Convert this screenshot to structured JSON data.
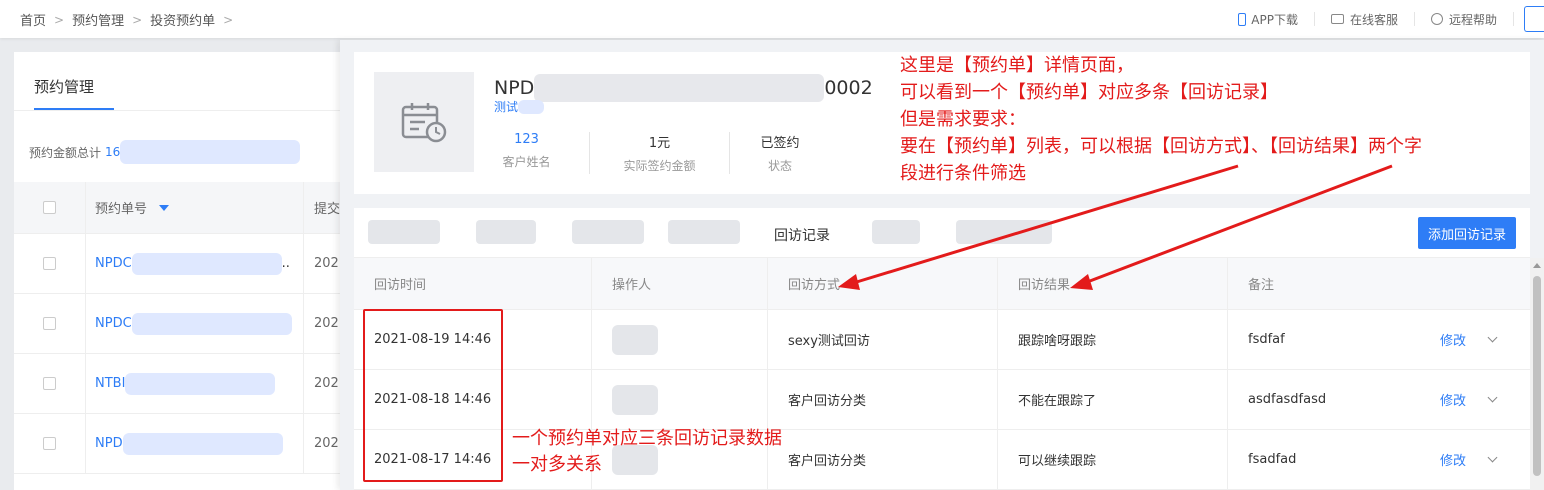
{
  "breadcrumb": [
    "首页",
    "预约管理",
    "投资预约单"
  ],
  "topbar": {
    "app_download": "APP下载",
    "online_service": "在线客服",
    "remote_help": "远程帮助"
  },
  "left_panel": {
    "title": "预约管理",
    "total_label": "预约金额总计",
    "total_value": "16",
    "col_order_no": "预约单号",
    "col_submit": "提交",
    "rows": [
      {
        "order_no": "NPDC",
        "submit": "202"
      },
      {
        "order_no": "NPDC",
        "submit": "202"
      },
      {
        "order_no": "NTBI",
        "submit": "202"
      },
      {
        "order_no": "NPD",
        "submit": "202"
      }
    ]
  },
  "detail": {
    "title_prefix": "NPD",
    "title_suffix": "0002",
    "subtitle": "测试",
    "stats": [
      {
        "value": "123",
        "label": "客户姓名"
      },
      {
        "value": "1元",
        "label": "实际签约金额"
      },
      {
        "value": "已签约",
        "label": "状态"
      }
    ],
    "active_tab": "回访记录",
    "add_button": "添加回访记录",
    "columns": [
      "回访时间",
      "操作人",
      "回访方式",
      "回访结果",
      "备注"
    ],
    "records": [
      {
        "time": "2021-08-19 14:46",
        "method": "sexy测试回访",
        "result": "跟踪啥呀跟踪",
        "remark": "fsdfaf",
        "action": "修改"
      },
      {
        "time": "2021-08-18 14:46",
        "method": "客户回访分类",
        "result": "不能在跟踪了",
        "remark": "asdfasdfasd",
        "action": "修改"
      },
      {
        "time": "2021-08-17 14:46",
        "method": "客户回访分类",
        "result": "可以继续跟踪",
        "remark": "fsadfad",
        "action": "修改"
      }
    ]
  },
  "annotations": {
    "top_note": [
      "这里是【预约单】详情页面，",
      "可以看到一个【预约单】对应多条【回访记录】",
      "但是需求要求：",
      "要在【预约单】列表，可以根据【回访方式】、【回访结果】两个字",
      "段进行条件筛选"
    ],
    "bottom_note": [
      "一个预约单对应三条回访记录数据",
      "一对多关系"
    ],
    "color": "#e31b1b"
  }
}
